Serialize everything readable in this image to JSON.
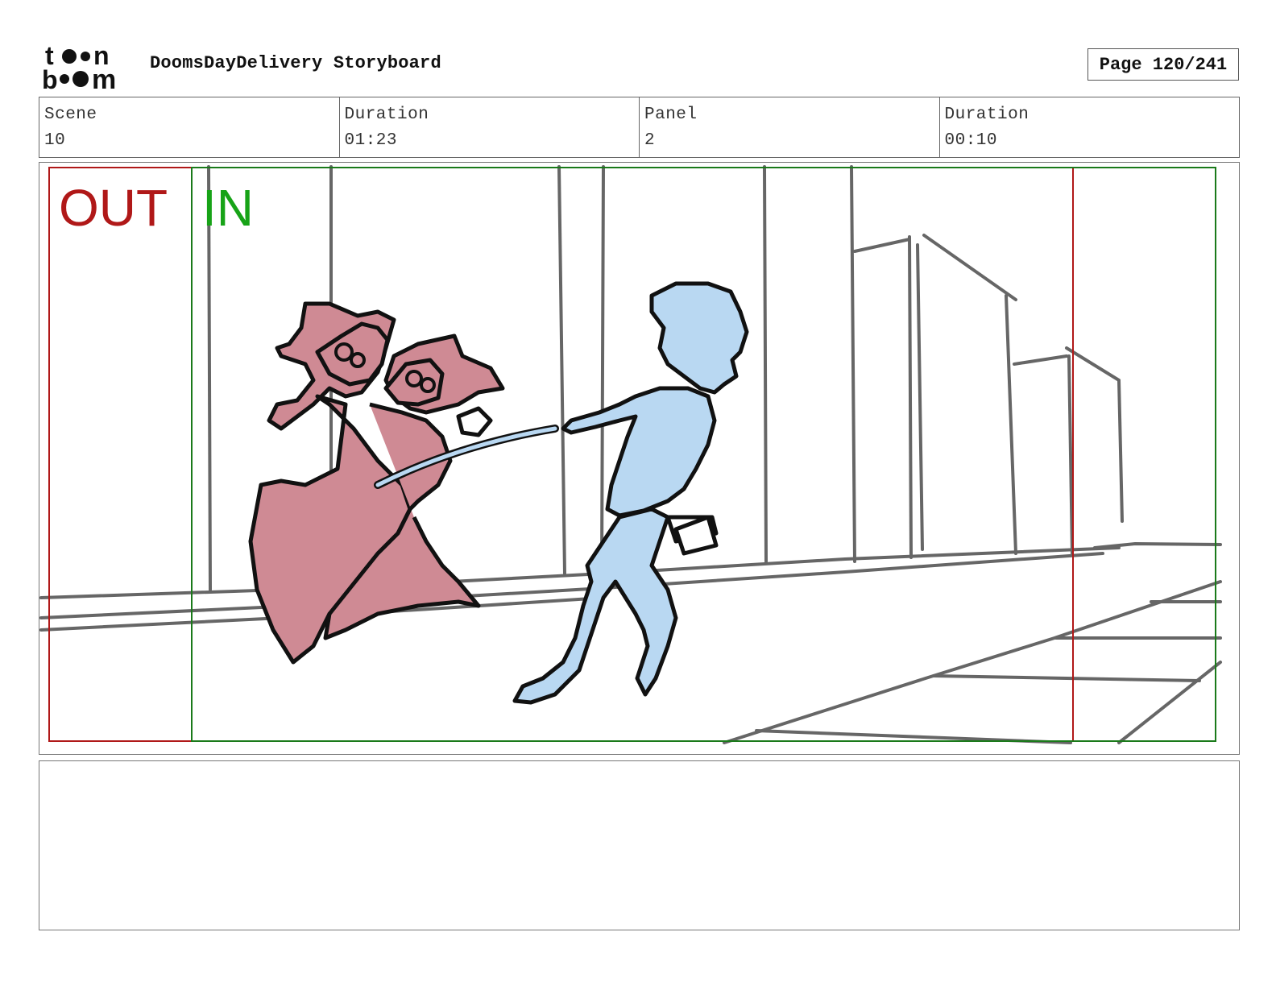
{
  "header": {
    "logo_text": "toon boom",
    "title": "DoomsDayDelivery Storyboard",
    "page": "Page 120/241"
  },
  "info": {
    "scene_label": "Scene",
    "scene_value": "10",
    "scene_duration_label": "Duration",
    "scene_duration_value": "01:23",
    "panel_label": "Panel",
    "panel_value": "2",
    "panel_duration_label": "Duration",
    "panel_duration_value": "00:10"
  },
  "panel_frame": {
    "out_label": "OUT",
    "in_label": "IN",
    "out_color": "#b01818",
    "in_color": "#17a317",
    "pink_fill": "#cf8a94",
    "blue_fill": "#b9d8f2"
  },
  "notes": {
    "text": ""
  }
}
